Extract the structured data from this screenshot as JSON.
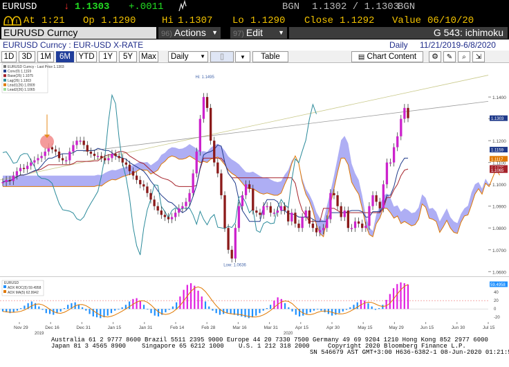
{
  "quote": {
    "ticker": "EURUSD",
    "arrow": "↓",
    "last": "1.1303",
    "change": "+.0011",
    "source_label": "BGN",
    "bid_ask": "1.1302 / 1.1303",
    "source_label2": "BGN",
    "at_label": "At",
    "at_time": "1:21",
    "open_label": "Op",
    "open": "1.1290",
    "hi_label": "Hi",
    "hi": "1.1307",
    "lo_label": "Lo",
    "lo": "1.1290",
    "close_label": "Close",
    "close": "1.1292",
    "value_label": "Value",
    "value_date": "06/10/20"
  },
  "toolbar": {
    "security": "EURUSD Curncy",
    "actions_num": "96)",
    "actions_label": "Actions",
    "edit_num": "97)",
    "edit_label": "Edit",
    "function": "G 543: ichimoku"
  },
  "subheader": {
    "name": "EURUSD Curncy : EUR-USD X-RATE",
    "frequency": "Daily",
    "range": "11/21/2019-6/8/2020"
  },
  "periods": [
    "1D",
    "3D",
    "1M",
    "6M",
    "YTD",
    "1Y",
    "5Y",
    "Max"
  ],
  "active_period": "6M",
  "controls": {
    "freq": "Daily",
    "table": "Table",
    "chart_content": "Chart Content"
  },
  "colors": {
    "up": "#cc22cc",
    "down": "#8b1a1a",
    "conv": "#1f3a8a",
    "base": "#a5222a",
    "lag": "#2a8a9a",
    "lead1": "#e07800",
    "cloud": "#8c8cf0",
    "trend": "#c9c98a",
    "trend2": "#9a9a9a",
    "adx_pos": "#1e90ff",
    "adx_neg": "#e020e0",
    "adx_ma": "#e07800"
  },
  "chart_data": [
    {
      "type": "candlestick",
      "title": "",
      "legend": [
        "EURUSD Curncy - Last Price 1.1303",
        "Conv(9) 1.1159",
        "Base(26) 1.1075",
        "Lag(26) 1.1303",
        "Lead1(26) 1.0909",
        "Lead2(26) 1.1065"
      ],
      "x_ticks": [
        "Nov 29",
        "Dec 16",
        "Dec 31",
        "Jan 15",
        "Jan 31",
        "Feb 14",
        "Feb 28",
        "Mar 16",
        "Mar 31",
        "Apr 15",
        "Apr 30",
        "May 15",
        "May 29",
        "Jun 15",
        "Jun 30",
        "Jul 15"
      ],
      "x_year_labels": [
        "2019",
        "2020"
      ],
      "y_ticks": [
        "1.1400",
        "1.1300",
        "1.1200",
        "1.1100",
        "1.1000",
        "1.0900",
        "1.0800",
        "1.0700",
        "1.0600"
      ],
      "ylim": [
        1.0585,
        1.1505
      ],
      "right_labels": [
        "1.1303",
        "1.1159",
        "1.1117",
        "1.1075",
        "1.1065"
      ],
      "annotations": {
        "high": "Hi: 1.1495",
        "low": "Low: 1.0636"
      },
      "values": [
        1.101,
        1.102,
        1.1015,
        1.104,
        1.106,
        1.1075,
        1.107,
        1.1085,
        1.11,
        1.111,
        1.112,
        1.113,
        1.115,
        1.117,
        1.116,
        1.115,
        1.112,
        1.111,
        1.111,
        1.115,
        1.118,
        1.12,
        1.12,
        1.118,
        1.115,
        1.114,
        1.113,
        1.113,
        1.112,
        1.111,
        1.112,
        1.114,
        1.113,
        1.112,
        1.11,
        1.109,
        1.106,
        1.104,
        1.102,
        1.1,
        1.099,
        1.096,
        1.093,
        1.09,
        1.088,
        1.086,
        1.085,
        1.084,
        1.085,
        1.087,
        1.089,
        1.09,
        1.092,
        1.096,
        1.105,
        1.115,
        1.13,
        1.14,
        1.135,
        1.12,
        1.11,
        1.105,
        1.095,
        1.08,
        1.07,
        1.066,
        1.08,
        1.09,
        1.095,
        1.1,
        1.098,
        1.088,
        1.087,
        1.086,
        1.09,
        1.09,
        1.087,
        1.087,
        1.088,
        1.09,
        1.088,
        1.083,
        1.087,
        1.082,
        1.08,
        1.085,
        1.088,
        1.082,
        1.08,
        1.078,
        1.079,
        1.08,
        1.084,
        1.096,
        1.095,
        1.09,
        1.085,
        1.088,
        1.08,
        1.08,
        1.083,
        1.082,
        1.08,
        1.081,
        1.09,
        1.095,
        1.092,
        1.089,
        1.1,
        1.11,
        1.11,
        1.117,
        1.122,
        1.13,
        1.135,
        1.1303
      ]
    },
    {
      "type": "bar",
      "title": "",
      "legend": [
        "EURUSD",
        "ADX ROC(5) 59.4958",
        "ADX MA(5) 62.9942"
      ],
      "y_ticks": [
        "60",
        "40",
        "20",
        "0",
        "-20"
      ],
      "ylim": [
        -28,
        72
      ],
      "right_label": "59.4958",
      "values": [
        -6,
        -8,
        -10,
        -8,
        -4,
        2,
        8,
        14,
        18,
        14,
        6,
        -2,
        -10,
        -12,
        -14,
        -10,
        -6,
        2,
        10,
        14,
        16,
        10,
        4,
        -4,
        -12,
        -18,
        -20,
        -22,
        -20,
        -16,
        -10,
        -4,
        0,
        4,
        10,
        18,
        24,
        26,
        20,
        10,
        0,
        -10,
        -16,
        -18,
        -14,
        -8,
        -2,
        6,
        16,
        30,
        46,
        58,
        62,
        56,
        44,
        30,
        18,
        6,
        -4,
        -10,
        -14,
        -12,
        -10,
        -12,
        -14,
        -16,
        -18,
        -20,
        -22,
        -20,
        -16,
        -10,
        -4,
        2,
        10,
        20,
        28,
        24,
        14,
        4,
        -6,
        -14,
        -18,
        -16,
        -12,
        -8,
        -4,
        0,
        -4,
        -8,
        -12,
        -16,
        -14,
        -10,
        -6,
        -2,
        4,
        10,
        16,
        22,
        20,
        14,
        6,
        -2,
        2,
        10,
        22,
        36,
        50,
        60,
        64,
        62,
        59
      ]
    }
  ],
  "footer": {
    "line1": "Australia 61 2 9777 8600 Brazil 5511 2395 9000 Europe 44 20 7330 7500 Germany 49 69 9204 1210 Hong Kong 852 2977 6000",
    "line2a": "Japan 81 3 4565 8900",
    "line2b": "Singapore 65 6212 1000",
    "line2c": "U.S. 1 212 318 2000",
    "line2d": "Copyright 2020 Bloomberg Finance L.P.",
    "line3": "SN 546679 AST  GMT+3:00 H636-6382-1 08-Jun-2020 01:21:55"
  }
}
